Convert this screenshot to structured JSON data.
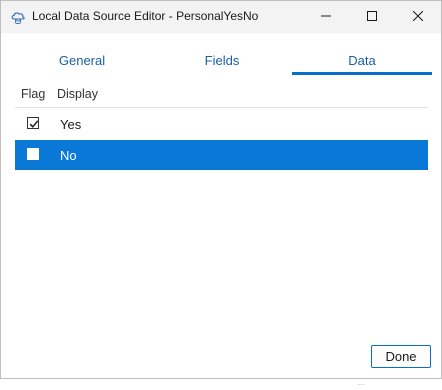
{
  "window": {
    "title": "Local Data Source Editor - PersonalYesNo",
    "app_icon": "cloud-database-icon",
    "controls": [
      "minimize-icon",
      "maximize-icon",
      "close-icon"
    ]
  },
  "tabs": [
    {
      "label": "General",
      "selected": false
    },
    {
      "label": "Fields",
      "selected": false
    },
    {
      "label": "Data",
      "selected": true
    }
  ],
  "grid": {
    "columns": [
      "Flag",
      "Display"
    ],
    "rows": [
      {
        "flag": true,
        "display": "Yes",
        "selected": false
      },
      {
        "flag": false,
        "display": "No",
        "selected": true
      }
    ]
  },
  "footer": {
    "done_label": "Done"
  },
  "colors": {
    "accent": "#0a78d7",
    "tab_text": "#1a5fa8",
    "titlebar_bg": "#f3f3f3"
  }
}
